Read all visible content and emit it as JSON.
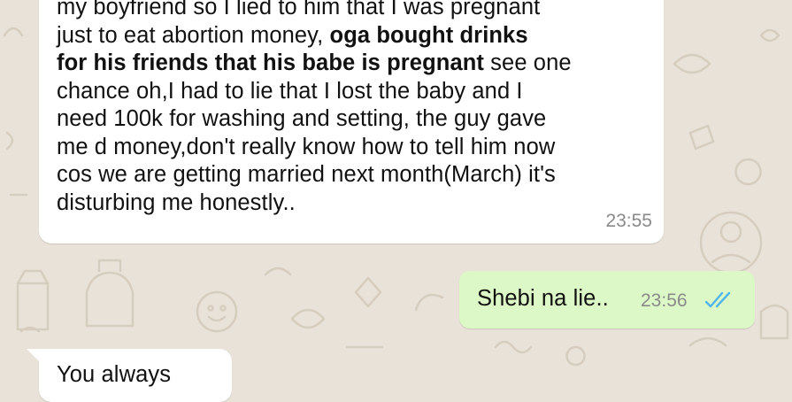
{
  "colors": {
    "wallpaper": "#e9e2d8",
    "incoming_bubble": "#ffffff",
    "outgoing_bubble": "#dcf8c6",
    "read_ticks": "#4fb6ec"
  },
  "messages": [
    {
      "direction": "incoming",
      "lines": [
        {
          "parts": [
            {
              "text": "my boyfriend so I lied to him that I was pregnant",
              "bold": false
            }
          ]
        },
        {
          "parts": [
            {
              "text": "just to eat abortion money, ",
              "bold": false
            },
            {
              "text": "oga bought drinks",
              "bold": true
            }
          ]
        },
        {
          "parts": [
            {
              "text": "for his friends that his babe is pregnant",
              "bold": true
            },
            {
              "text": " see one",
              "bold": false
            }
          ]
        },
        {
          "parts": [
            {
              "text": "chance oh,I had to lie that I lost the baby and I",
              "bold": false
            }
          ]
        },
        {
          "parts": [
            {
              "text": "need 100k for washing and setting, the guy gave",
              "bold": false
            }
          ]
        },
        {
          "parts": [
            {
              "text": "me d money,don't really know how to tell him now",
              "bold": false
            }
          ]
        },
        {
          "parts": [
            {
              "text": "cos we are getting married next month(March) it's",
              "bold": false
            }
          ]
        },
        {
          "parts": [
            {
              "text": "disturbing me honestly..",
              "bold": false
            }
          ]
        }
      ],
      "time": "23:55"
    },
    {
      "direction": "outgoing",
      "text": "Shebi na lie..",
      "time": "23:56",
      "status_icon": "double-check-read-icon"
    },
    {
      "direction": "incoming",
      "text": "You always",
      "time": ""
    }
  ]
}
